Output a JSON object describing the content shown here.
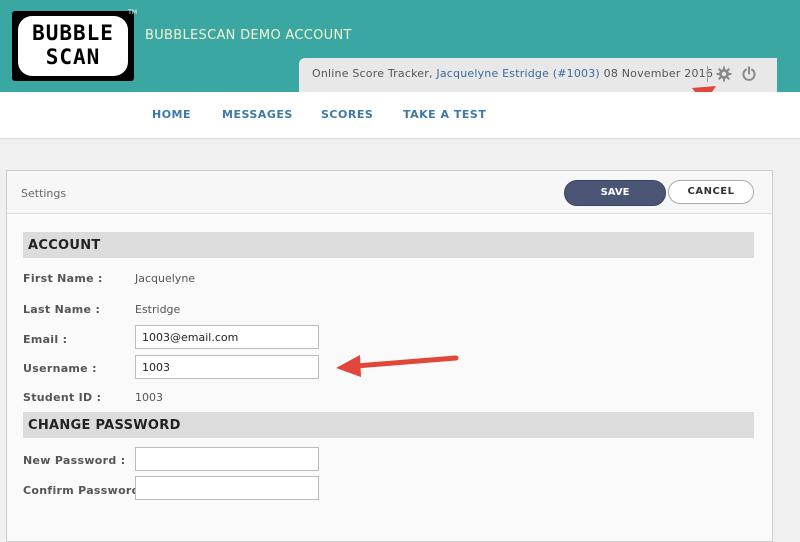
{
  "header": {
    "logo_line1": "BUBBLE",
    "logo_line2": "SCAN",
    "logo_tm": "TM",
    "account_title": "BUBBLESCAN DEMO ACCOUNT",
    "tracker_prefix": "Online Score Tracker,",
    "tracker_user": "Jacquelyne Estridge (#1003)",
    "tracker_date": "08 November 2016",
    "settings_icon": "gear-icon",
    "logout_icon": "power-icon"
  },
  "nav": {
    "items": [
      {
        "label": "HOME"
      },
      {
        "label": "MESSAGES"
      },
      {
        "label": "SCORES"
      },
      {
        "label": "TAKE A TEST"
      }
    ]
  },
  "settings": {
    "title": "Settings",
    "save_label": "SAVE",
    "cancel_label": "CANCEL",
    "account_section": "ACCOUNT",
    "first_name_label": "First Name :",
    "first_name_value": "Jacquelyne",
    "last_name_label": "Last Name :",
    "last_name_value": "Estridge",
    "email_label": "Email :",
    "email_value": "1003@email.com",
    "username_label": "Username :",
    "username_value": "1003",
    "student_id_label": "Student ID :",
    "student_id_value": "1003",
    "password_section": "CHANGE PASSWORD",
    "new_password_label": "New Password :",
    "new_password_value": "",
    "confirm_password_label": "Confirm Password :",
    "confirm_password_value": ""
  },
  "colors": {
    "header_bg": "#3aa7a3",
    "nav_link": "#3e78a8",
    "save_button": "#4a5576",
    "annotation_arrow": "#e0463a"
  }
}
